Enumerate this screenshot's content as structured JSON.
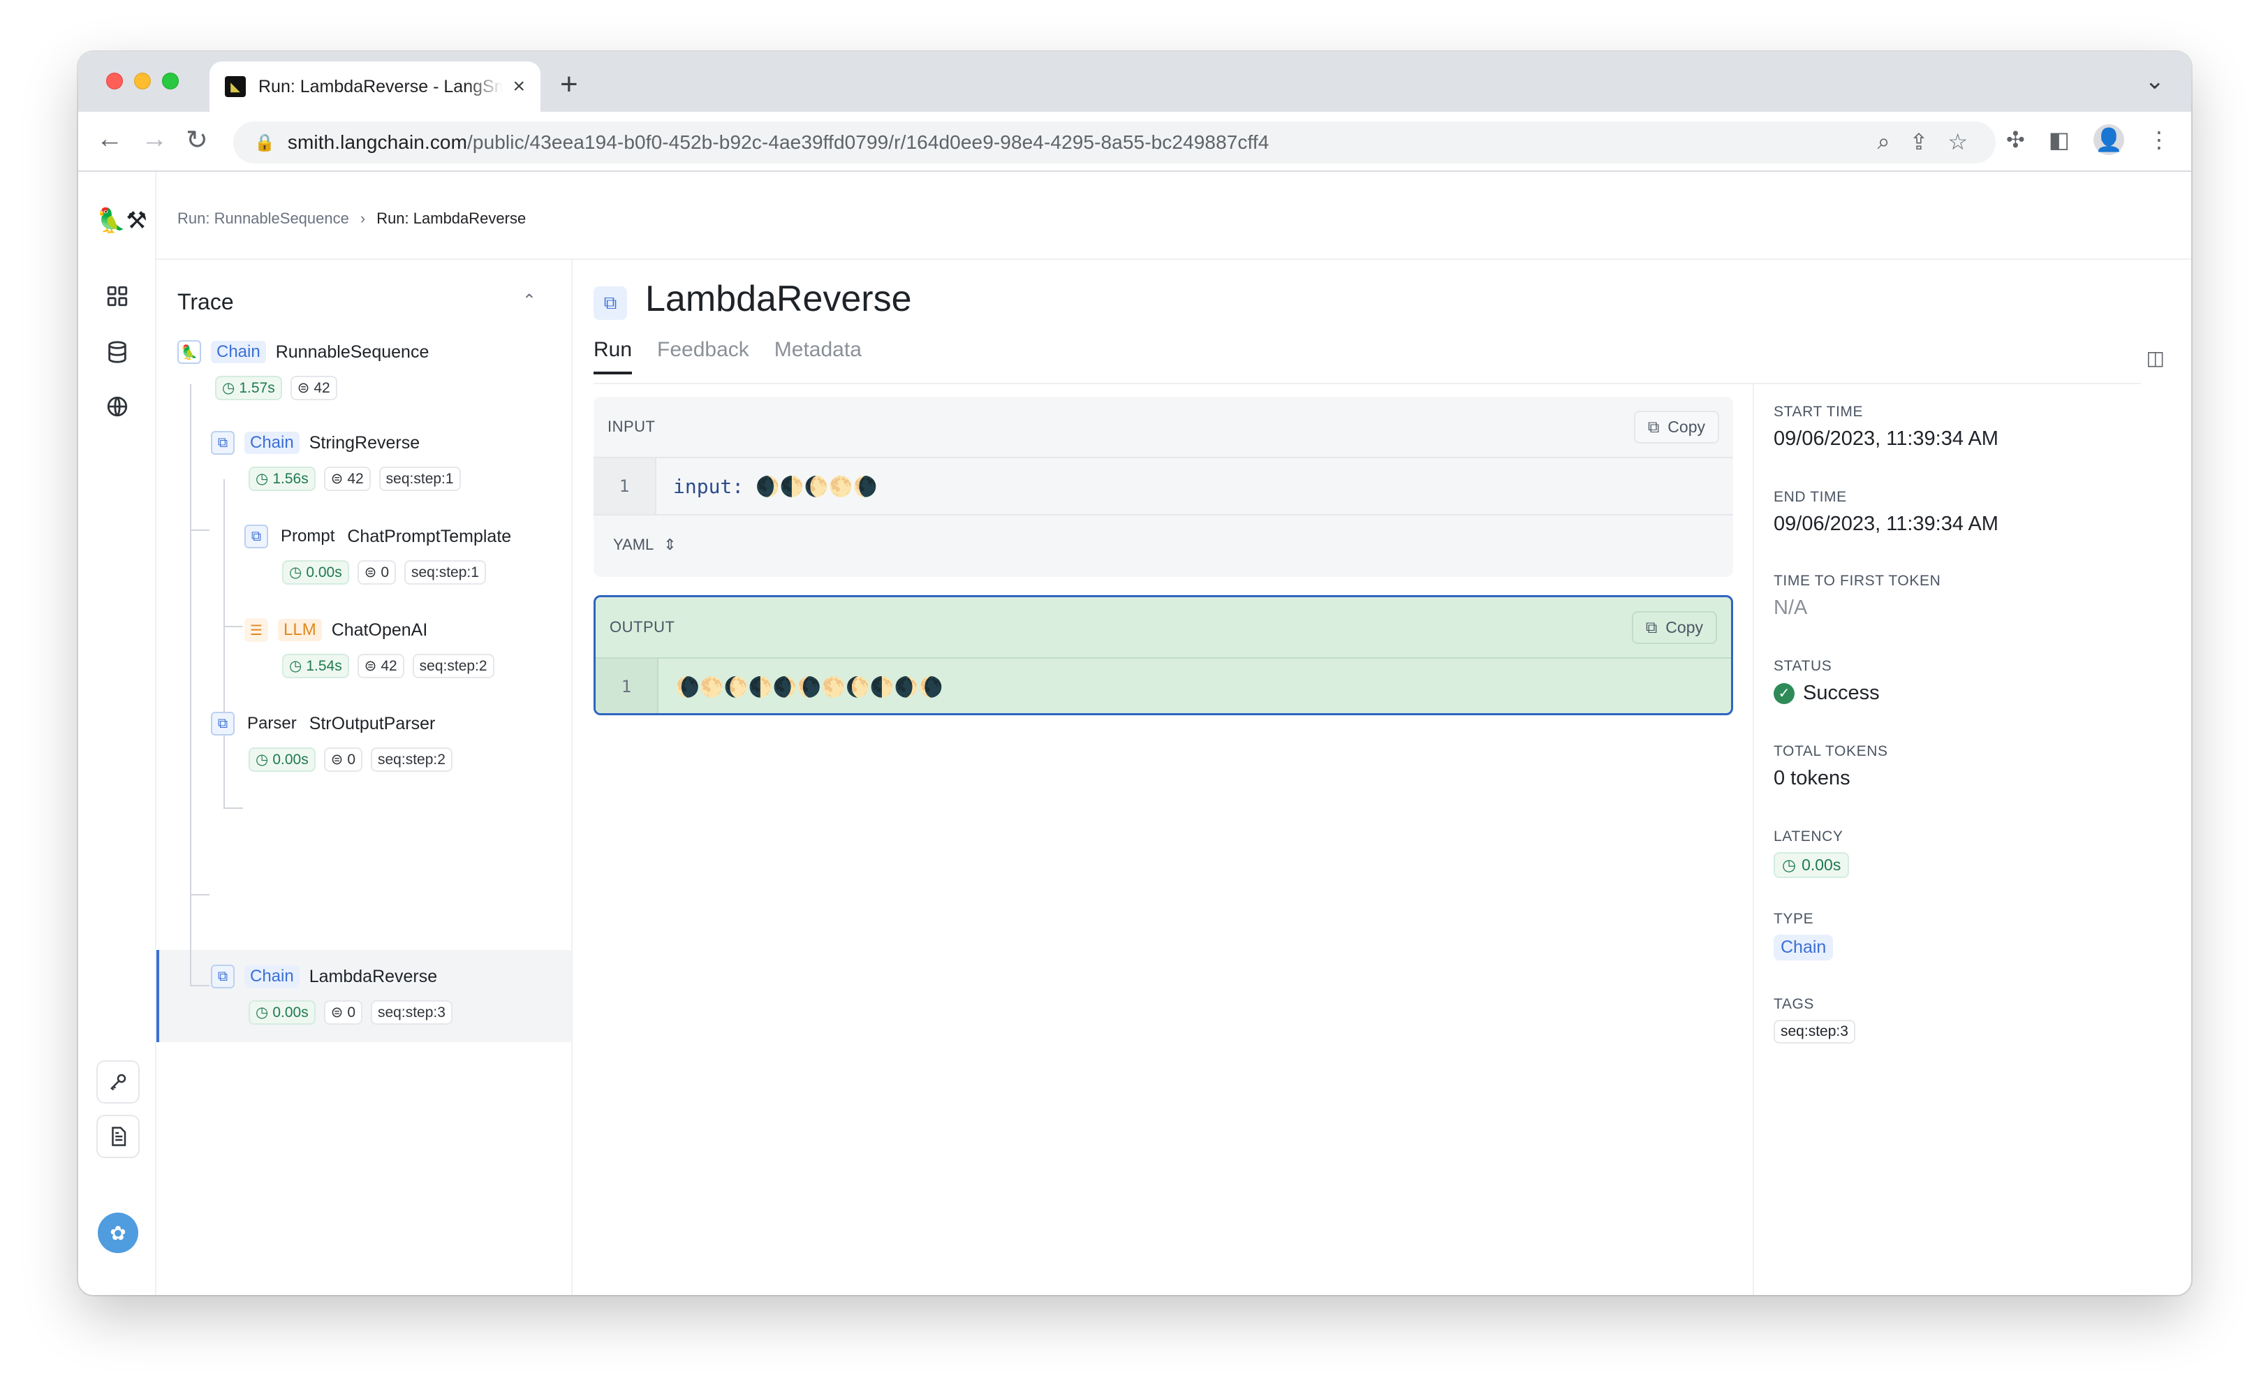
{
  "browser": {
    "tab_title": "Run: LambdaReverse - LangSmith",
    "url_host": "smith.langchain.com",
    "url_path": "/public/43eea194-b0f0-452b-b92c-4ae39ffd0799/r/164d0ee9-98e4-4295-8a55-bc249887cff4"
  },
  "breadcrumb": {
    "parent": "Run: RunnableSequence",
    "current": "Run: LambdaReverse"
  },
  "trace": {
    "title": "Trace",
    "nodes": [
      {
        "type": "Chain",
        "name": "RunnableSequence",
        "time": "1.57s",
        "tokens": "42",
        "tag": ""
      },
      {
        "type": "Chain",
        "name": "StringReverse",
        "time": "1.56s",
        "tokens": "42",
        "tag": "seq:step:1"
      },
      {
        "type": "Prompt",
        "name": "ChatPromptTemplate",
        "time": "0.00s",
        "tokens": "0",
        "tag": "seq:step:1"
      },
      {
        "type": "LLM",
        "name": "ChatOpenAI",
        "time": "1.54s",
        "tokens": "42",
        "tag": "seq:step:2"
      },
      {
        "type": "Parser",
        "name": "StrOutputParser",
        "time": "0.00s",
        "tokens": "0",
        "tag": "seq:step:2"
      },
      {
        "type": "Chain",
        "name": "LambdaReverse",
        "time": "0.00s",
        "tokens": "0",
        "tag": "seq:step:3"
      }
    ]
  },
  "main": {
    "title": "LambdaReverse",
    "tabs": [
      "Run",
      "Feedback",
      "Metadata"
    ],
    "input": {
      "label": "INPUT",
      "copy_label": "Copy",
      "line_no": "1",
      "code_key": "input:",
      "code_value": "🌒🌓🌔🌕🌘",
      "format_label": "YAML"
    },
    "output": {
      "label": "OUTPUT",
      "copy_label": "Copy",
      "line_no": "1",
      "code_value": "🌘🌕🌔🌓🌒🌘🌕🌔🌓🌒🌘"
    }
  },
  "details": {
    "start_time_label": "START TIME",
    "start_time": "09/06/2023, 11:39:34 AM",
    "end_time_label": "END TIME",
    "end_time": "09/06/2023, 11:39:34 AM",
    "ttft_label": "TIME TO FIRST TOKEN",
    "ttft": "N/A",
    "status_label": "STATUS",
    "status": "Success",
    "total_tokens_label": "TOTAL TOKENS",
    "total_tokens": "0 tokens",
    "latency_label": "LATENCY",
    "latency": "0.00s",
    "type_label": "TYPE",
    "type": "Chain",
    "tags_label": "TAGS",
    "tag": "seq:step:3"
  }
}
